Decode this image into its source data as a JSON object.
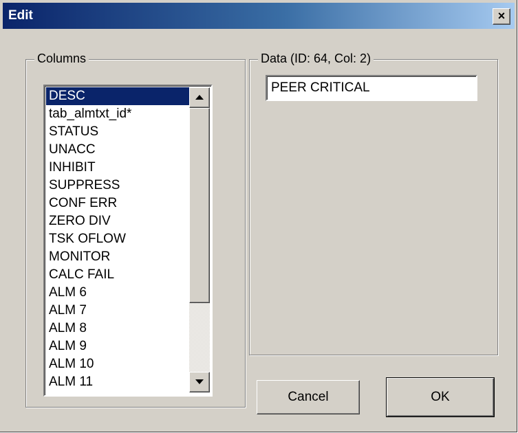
{
  "window": {
    "title": "Edit",
    "close_label": "×"
  },
  "columns_group": {
    "label": "Columns",
    "items": [
      {
        "label": "DESC",
        "selected": true
      },
      {
        "label": "tab_almtxt_id*"
      },
      {
        "label": "STATUS"
      },
      {
        "label": "UNACC"
      },
      {
        "label": "INHIBIT"
      },
      {
        "label": "SUPPRESS"
      },
      {
        "label": "CONF ERR"
      },
      {
        "label": "ZERO DIV"
      },
      {
        "label": "TSK OFLOW"
      },
      {
        "label": "MONITOR"
      },
      {
        "label": "CALC FAIL"
      },
      {
        "label": "ALM  6"
      },
      {
        "label": "ALM  7"
      },
      {
        "label": "ALM  8"
      },
      {
        "label": "ALM  9"
      },
      {
        "label": "ALM 10"
      },
      {
        "label": "ALM 11"
      }
    ]
  },
  "data_group": {
    "label": "Data (ID: 64, Col: 2)",
    "value": "PEER CRITICAL"
  },
  "buttons": {
    "cancel_label": "Cancel",
    "ok_label": "OK"
  },
  "colors": {
    "titlebar_start": "#0a246a",
    "titlebar_end": "#a6caf0",
    "selection": "#0a246a",
    "face": "#d4d0c8"
  },
  "icons": {
    "close": "close-icon",
    "scroll_up": "arrow-up-icon",
    "scroll_down": "arrow-down-icon"
  }
}
